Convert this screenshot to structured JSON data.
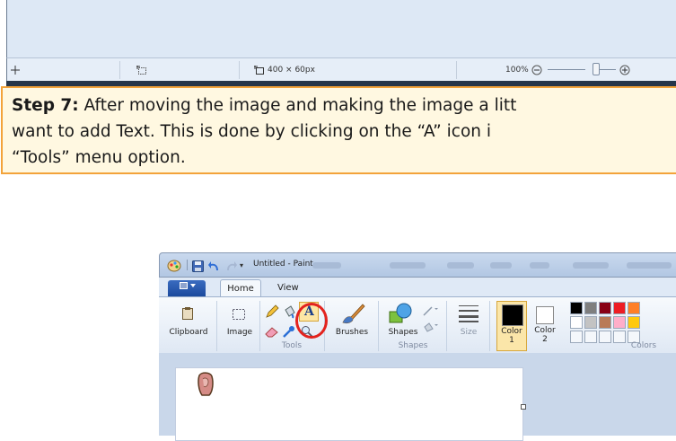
{
  "top_statusbar": {
    "move_icon": "move-cursor-icon",
    "selection_icon": "selection-size-icon",
    "canvas_icon": "canvas-size-icon",
    "canvas_size": "400 × 60px",
    "zoom_level": "100%",
    "zoom_out_icon": "zoom-out-icon",
    "zoom_in_icon": "zoom-in-icon",
    "zoom_slider_level": 0.5
  },
  "step": {
    "label": "Step 7:",
    "line1": " After moving the image and making the image a litt",
    "line2": "want to add Text.  This is done by clicking on the “A” icon i",
    "line3": "“Tools” menu option."
  },
  "paint": {
    "title": "Untitled - Paint",
    "file_menu_icon": "file-menu-icon",
    "tabs": [
      "Home",
      "View"
    ],
    "groups": {
      "clipboard": "Clipboard",
      "image": "Image",
      "tools": "Tools",
      "brushes": "Brushes",
      "shapes_button": "Shapes",
      "shapes_group": "Shapes",
      "size": "Size",
      "color1": "Color 1",
      "color2": "Color 2",
      "colors": "Colors"
    },
    "color1_number": "1",
    "color2_number": "2",
    "colors": {
      "accent_highlight": "#e3231e",
      "ribbon_bg": "#dfe8f4",
      "step_border": "#f3a33a",
      "step_bg": "#fff8e1",
      "palette_row1": [
        "#000000",
        "#7f7f7f",
        "#880015",
        "#ed1c24",
        "#ff7f27"
      ],
      "palette_row2": [
        "#ffffff",
        "#c3c3c3",
        "#b97a57",
        "#ffaec9",
        "#ffc90e"
      ]
    }
  }
}
